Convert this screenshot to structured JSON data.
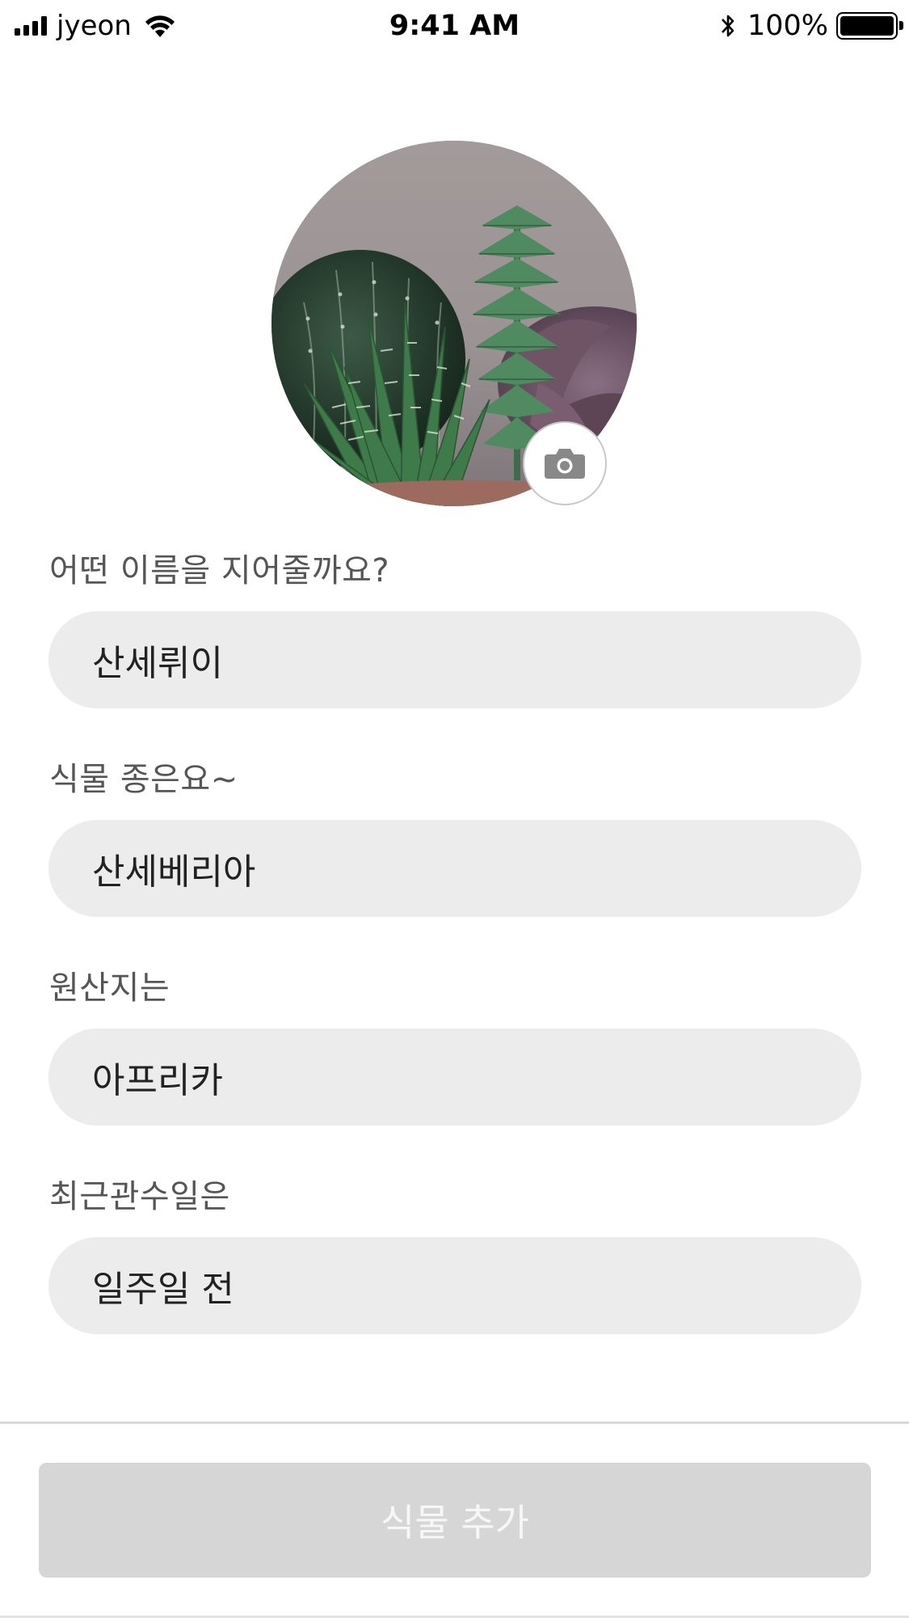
{
  "status_bar": {
    "carrier": "jyeon",
    "time": "9:41 AM",
    "battery_percent": "100%",
    "battery_level": 1.0,
    "icons": [
      "signal-icon",
      "wifi-icon",
      "bluetooth-icon",
      "battery-icon"
    ]
  },
  "photo": {
    "camera_icon": "camera-icon"
  },
  "form": {
    "name_label": "어떤 이름을 지어줄까요?",
    "name_value": "산세뤼이",
    "species_label": "식물 종은요~",
    "species_value": "산세베리아",
    "origin_label": "원산지는",
    "origin_value": "아프리카",
    "watering_label": "최근관수일은",
    "watering_value": "일주일 전"
  },
  "submit": {
    "label": "식물 추가"
  },
  "colors": {
    "field_background": "#ececec",
    "button_disabled": "#d6d6d6",
    "label_text": "#555555"
  }
}
